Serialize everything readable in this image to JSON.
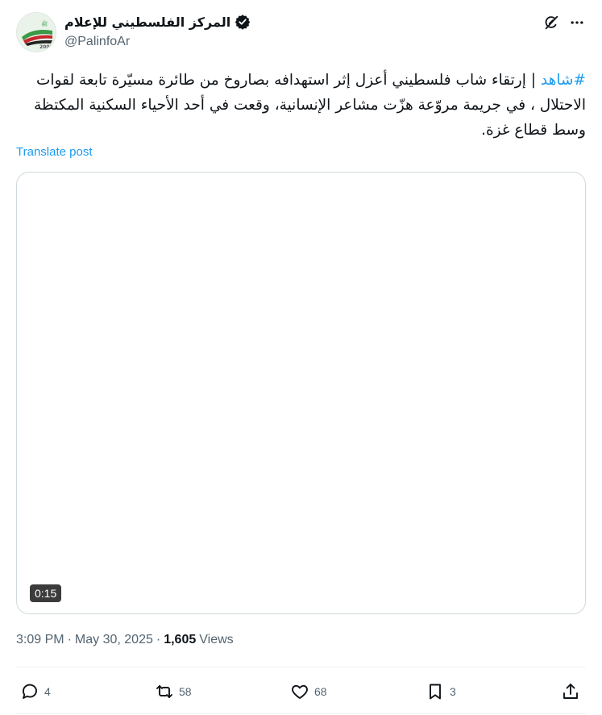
{
  "author": {
    "display_name": "المركز الفلسطيني للإعلام",
    "handle": "@PalinfoAr"
  },
  "tweet": {
    "hashtag": "#شاهد",
    "text": " | إرتقاء شاب فلسطيني أعزل إثر استهدافه بصاروخ من طائرة مسيّرة تابعة لقوات الاحتلال ، في جريمة مروّعة هزّت مشاعر الإنسانية، وقعت في أحد الأحياء السكنية المكتظة وسط قطاع غزة."
  },
  "translate_label": "Translate post",
  "media": {
    "duration": "0:15"
  },
  "meta": {
    "time": "3:09 PM",
    "separator": "·",
    "date": "May 30, 2025",
    "views_count": "1,605",
    "views_label": "Views"
  },
  "actions": {
    "replies": "4",
    "retweets": "58",
    "likes": "68",
    "bookmarks": "3"
  },
  "colors": {
    "accent": "#1d9bf0",
    "muted": "#536471",
    "border": "#cfd9de"
  },
  "icons": [
    "grok-icon",
    "more-icon",
    "verified-badge-icon",
    "reply-icon",
    "retweet-icon",
    "like-icon",
    "bookmark-icon",
    "share-icon"
  ]
}
